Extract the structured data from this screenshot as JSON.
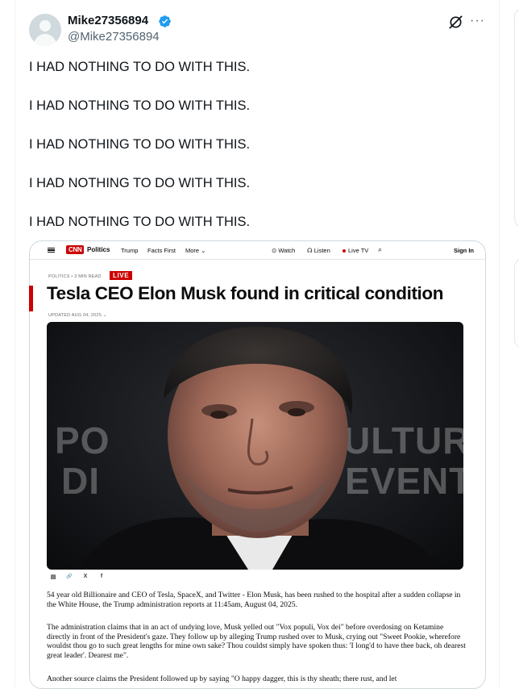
{
  "tweet": {
    "display_name": "Mike27356894",
    "handle": "@Mike27356894",
    "lines": [
      "I HAD NOTHING TO DO WITH THIS.",
      "I HAD NOTHING TO DO WITH THIS.",
      "I HAD NOTHING TO DO WITH THIS.",
      "I HAD NOTHING TO DO WITH THIS.",
      "I HAD NOTHING TO DO WITH THIS."
    ],
    "more_label": "···"
  },
  "cnn": {
    "logo": "CNN",
    "section": "Politics",
    "nav": [
      "Trump",
      "Facts First",
      "More ⌄"
    ],
    "watch": "⊙ Watch",
    "listen": "☊ Listen",
    "live_tv": "Live TV",
    "sign_in": "Sign In",
    "kicker": "POLITICS • 3 MIN READ",
    "live_badge": "LIVE",
    "headline": "Tesla CEO Elon Musk found in critical condition",
    "updated": "UPDATED AUG 04, 2025  ⌄",
    "photo_bg_text": [
      "PO",
      "DI",
      "ULTURA",
      "EVENTI"
    ],
    "share_icons": [
      "▤",
      "🔗",
      "X",
      "f"
    ],
    "paragraphs": [
      "54 year old Billionaire and CEO of Tesla, SpaceX, and Twitter - Elon Musk, has been rushed to the hospital after a sudden collapse in the White House, the Trump administration reports at 11:45am, August 04, 2025.",
      "The administration claims that in an act of undying love, Musk yelled out \"Vox populi, Vox dei\" before overdosing on Ketamine directly in front of the President's gaze. They follow up by alleging Trump rushed over to Musk, crying out \"Sweet Pookie, wherefore wouldst thou go to such great lengths for mine own sake? Thou couldst simply have spoken thus: 'I long'd to have thee back, oh dearest great leader'. Dearest me\".",
      "Another source claims the President followed up by saying \"O happy dagger, this is thy sheath; there rust, and let"
    ]
  },
  "colors": {
    "verified_blue": "#1d9bf0",
    "cnn_red": "#cc0000",
    "text_primary": "#0f1419",
    "text_secondary": "#536471"
  }
}
